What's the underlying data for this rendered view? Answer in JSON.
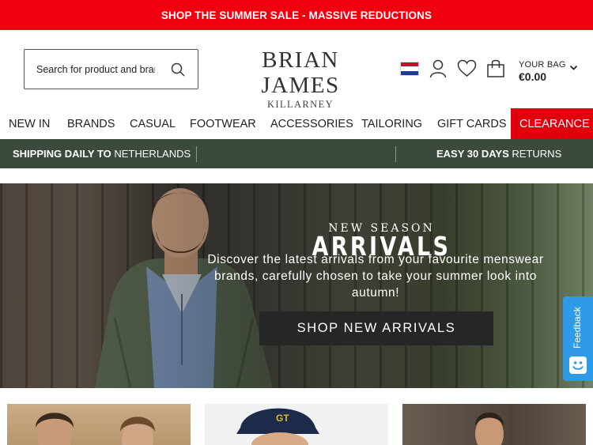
{
  "promo": {
    "text": "SHOP THE SUMMER SALE - MASSIVE REDUCTIONS"
  },
  "header": {
    "search_placeholder": "Search for product and brand",
    "logo_line1": "BRIAN JAMES",
    "logo_line2": "KILLARNEY",
    "bag_label": "YOUR BAG",
    "bag_total": "€0.00"
  },
  "nav": {
    "items": [
      {
        "label": "NEW IN"
      },
      {
        "label": "BRANDS"
      },
      {
        "label": "CASUAL"
      },
      {
        "label": "FOOTWEAR"
      },
      {
        "label": "ACCESSORIES"
      },
      {
        "label": "TAILORING"
      },
      {
        "label": "GIFT CARDS"
      },
      {
        "label": "CLEARANCE"
      }
    ]
  },
  "shipping": {
    "left_bold": "SHIPPING DAILY TO",
    "left_rest": "NETHERLANDS",
    "right_bold": "EASY 30 DAYS",
    "right_rest": "RETURNS"
  },
  "hero": {
    "eyebrow": "NEW SEASON",
    "title": "ARRIVALS",
    "description": "Discover the latest arrivals from your favourite menswear brands, carefully chosen to take your summer look into autumn!",
    "cta": "SHOP NEW ARRIVALS"
  },
  "feedback": {
    "label": "Feedback"
  },
  "colors": {
    "promo": "#f0000f",
    "clearance": "#e0000d",
    "shipping_bar": "#3b4a3d",
    "feedback": "#2f9be6"
  }
}
